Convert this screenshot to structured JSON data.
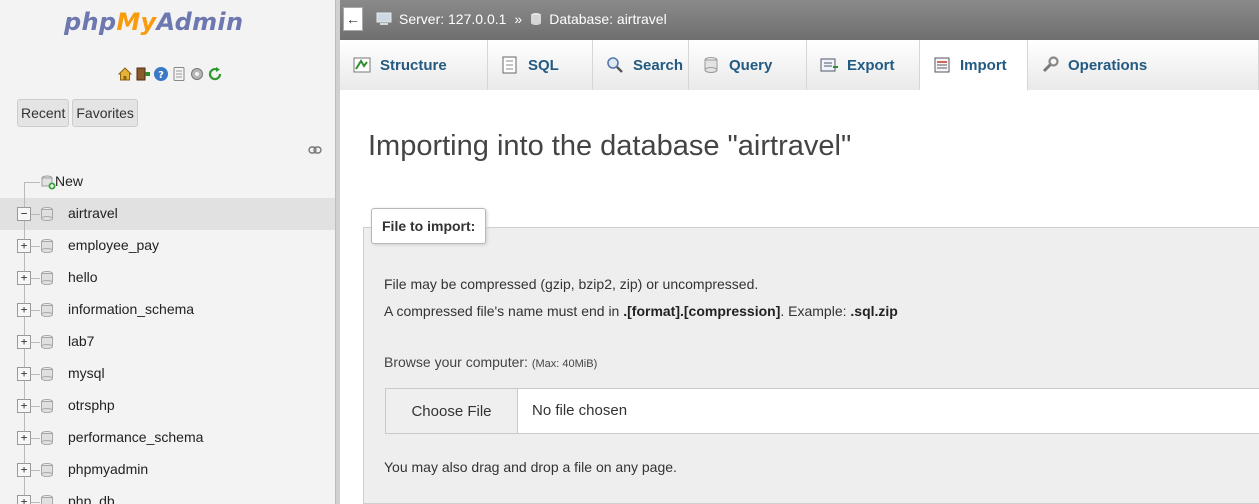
{
  "nav": {
    "logo": {
      "part1": "php",
      "part2": "My",
      "part3": "Admin"
    },
    "quick_icons": [
      "home-icon",
      "exit-icon",
      "help-icon",
      "docs-icon",
      "settings-icon",
      "reload-icon"
    ],
    "recent_label": "Recent",
    "favorites_label": "Favorites",
    "tree": [
      {
        "label": "New",
        "type": "new"
      },
      {
        "label": "airtravel",
        "type": "db",
        "expanded": true,
        "selected": true
      },
      {
        "label": "employee_pay",
        "type": "db"
      },
      {
        "label": "hello",
        "type": "db"
      },
      {
        "label": "information_schema",
        "type": "db"
      },
      {
        "label": "lab7",
        "type": "db"
      },
      {
        "label": "mysql",
        "type": "db"
      },
      {
        "label": "otrsphp",
        "type": "db"
      },
      {
        "label": "performance_schema",
        "type": "db"
      },
      {
        "label": "phpmyadmin",
        "type": "db"
      },
      {
        "label": "php_db",
        "type": "db"
      }
    ]
  },
  "breadcrumb": {
    "back": "←",
    "server": "Server: 127.0.0.1",
    "sep": "»",
    "database": "Database: airtravel"
  },
  "tabs": [
    {
      "label": "Structure",
      "icon": "structure-icon"
    },
    {
      "label": "SQL",
      "icon": "sql-icon"
    },
    {
      "label": "Search",
      "icon": "search-icon"
    },
    {
      "label": "Query",
      "icon": "query-icon"
    },
    {
      "label": "Export",
      "icon": "export-icon"
    },
    {
      "label": "Import",
      "icon": "import-icon",
      "active": true
    },
    {
      "label": "Operations",
      "icon": "operations-icon"
    }
  ],
  "main": {
    "title": "Importing into the database \"airtravel\"",
    "legend": "File to import:",
    "desc1": "File may be compressed (gzip, bzip2, zip) or uncompressed.",
    "desc2_pre": "A compressed file's name must end in ",
    "desc2_bold": ".[format].[compression]",
    "desc2_mid": ". Example: ",
    "desc2_example": ".sql.zip",
    "browse_label": "Browse your computer: ",
    "browse_max": "(Max: 40MiB)",
    "choose_file": "Choose File",
    "no_file": "No file chosen",
    "drag_note": "You may also drag and drop a file on any page."
  }
}
